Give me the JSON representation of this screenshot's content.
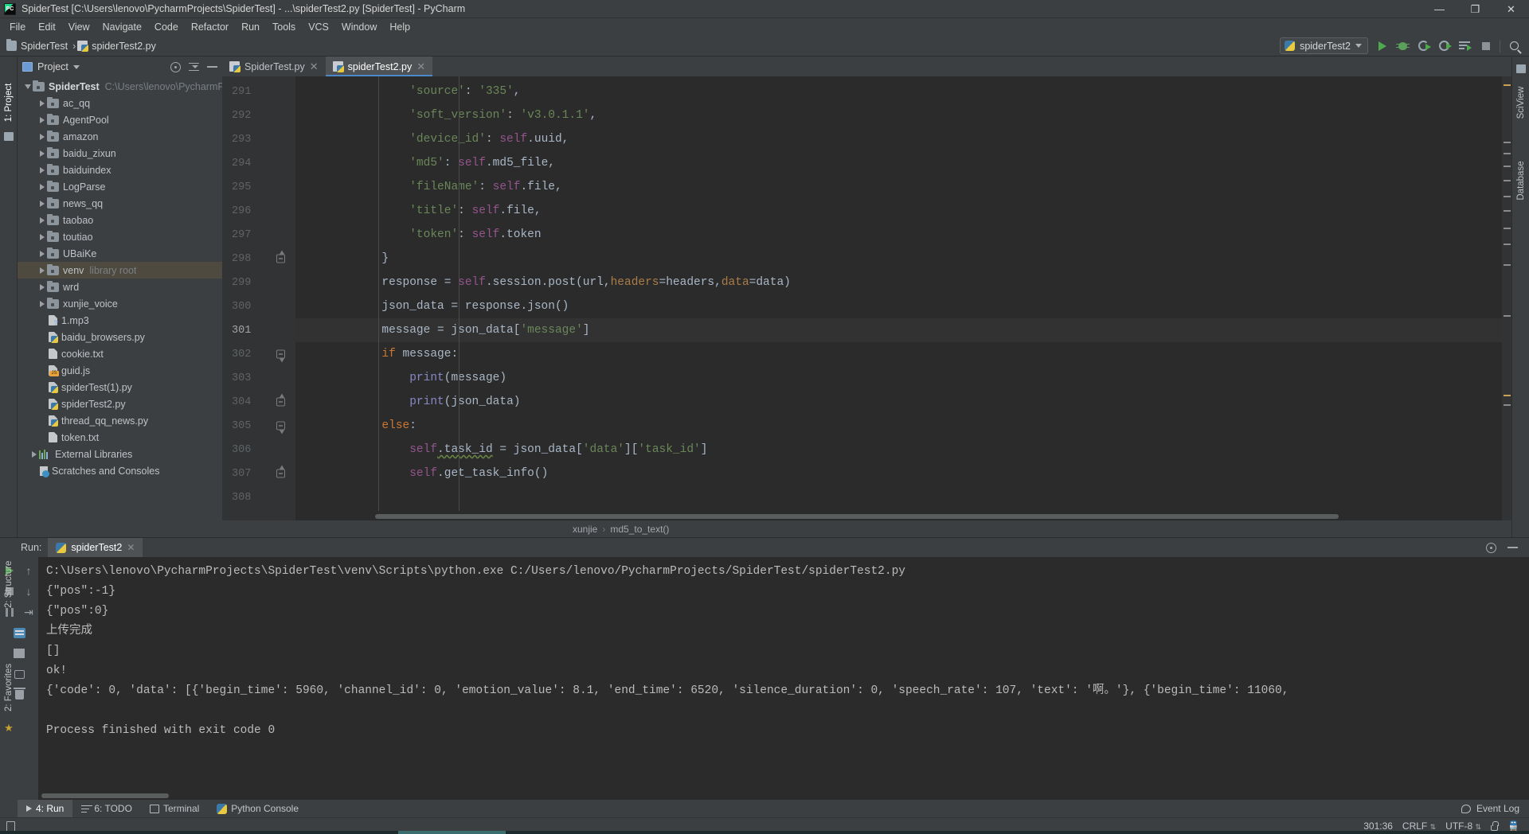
{
  "window": {
    "title": "SpiderTest [C:\\Users\\lenovo\\PycharmProjects\\SpiderTest] - ...\\spiderTest2.py [SpiderTest] - PyCharm",
    "minimize": "—",
    "maximize": "❐",
    "close": "✕"
  },
  "menu": [
    "File",
    "Edit",
    "View",
    "Navigate",
    "Code",
    "Refactor",
    "Run",
    "Tools",
    "VCS",
    "Window",
    "Help"
  ],
  "navbar": {
    "crumbs": [
      "SpiderTest",
      "spiderTest2.py"
    ],
    "run_config": "spiderTest2"
  },
  "left_strip": {
    "project_label": "1: Project",
    "structure_label": "2: Structure",
    "favorites_label": "2: Favorites"
  },
  "right_strip": {
    "sciview_label": "SciView",
    "database_label": "Database"
  },
  "project": {
    "title": "Project",
    "root": {
      "label": "SpiderTest",
      "path": "C:\\Users\\lenovo\\PycharmProjects\\Sp"
    },
    "items": [
      {
        "label": "ac_qq",
        "type": "folder"
      },
      {
        "label": "AgentPool",
        "type": "folder"
      },
      {
        "label": "amazon",
        "type": "folder"
      },
      {
        "label": "baidu_zixun",
        "type": "folder"
      },
      {
        "label": "baiduindex",
        "type": "folder"
      },
      {
        "label": "LogParse",
        "type": "folder"
      },
      {
        "label": "news_qq",
        "type": "folder"
      },
      {
        "label": "taobao",
        "type": "folder"
      },
      {
        "label": "toutiao",
        "type": "folder"
      },
      {
        "label": "UBaiKe",
        "type": "folder"
      },
      {
        "label": "venv",
        "type": "folder",
        "note": "library root",
        "selected": true
      },
      {
        "label": "wrd",
        "type": "folder"
      },
      {
        "label": "xunjie_voice",
        "type": "folder"
      },
      {
        "label": "1.mp3",
        "type": "unknown"
      },
      {
        "label": "baidu_browsers.py",
        "type": "py"
      },
      {
        "label": "cookie.txt",
        "type": "txt"
      },
      {
        "label": "guid.js",
        "type": "js"
      },
      {
        "label": "spiderTest(1).py",
        "type": "py"
      },
      {
        "label": "spiderTest2.py",
        "type": "py"
      },
      {
        "label": "thread_qq_news.py",
        "type": "py"
      },
      {
        "label": "token.txt",
        "type": "txt"
      },
      {
        "label": "External Libraries",
        "type": "lib"
      },
      {
        "label": "Scratches and Consoles",
        "type": "scratch"
      }
    ]
  },
  "editor": {
    "tabs": [
      {
        "label": "SpiderTest.py",
        "active": false,
        "close": "✕"
      },
      {
        "label": "spiderTest2.py",
        "active": true,
        "close": "✕"
      }
    ],
    "current_line": 301,
    "lines": [
      {
        "no": 291,
        "fold": "",
        "tokens": [
          {
            "t": "                ",
            "c": "tok-plain"
          },
          {
            "t": "'source'",
            "c": "tok-str"
          },
          {
            "t": ": ",
            "c": "tok-plain"
          },
          {
            "t": "'335'",
            "c": "tok-str"
          },
          {
            "t": ",",
            "c": "tok-plain"
          }
        ]
      },
      {
        "no": 292,
        "fold": "",
        "tokens": [
          {
            "t": "                ",
            "c": "tok-plain"
          },
          {
            "t": "'soft_version'",
            "c": "tok-str"
          },
          {
            "t": ": ",
            "c": "tok-plain"
          },
          {
            "t": "'v3.0.1.1'",
            "c": "tok-str"
          },
          {
            "t": ",",
            "c": "tok-plain"
          }
        ]
      },
      {
        "no": 293,
        "fold": "",
        "tokens": [
          {
            "t": "                ",
            "c": "tok-plain"
          },
          {
            "t": "'device_id'",
            "c": "tok-str"
          },
          {
            "t": ": ",
            "c": "tok-plain"
          },
          {
            "t": "self",
            "c": "tok-self"
          },
          {
            "t": ".uuid,",
            "c": "tok-plain"
          }
        ]
      },
      {
        "no": 294,
        "fold": "",
        "tokens": [
          {
            "t": "                ",
            "c": "tok-plain"
          },
          {
            "t": "'md5'",
            "c": "tok-str"
          },
          {
            "t": ": ",
            "c": "tok-plain"
          },
          {
            "t": "self",
            "c": "tok-self"
          },
          {
            "t": ".md5_file,",
            "c": "tok-plain"
          }
        ]
      },
      {
        "no": 295,
        "fold": "",
        "tokens": [
          {
            "t": "                ",
            "c": "tok-plain"
          },
          {
            "t": "'fileName'",
            "c": "tok-str"
          },
          {
            "t": ": ",
            "c": "tok-plain"
          },
          {
            "t": "self",
            "c": "tok-self"
          },
          {
            "t": ".file,",
            "c": "tok-plain"
          }
        ]
      },
      {
        "no": 296,
        "fold": "",
        "tokens": [
          {
            "t": "                ",
            "c": "tok-plain"
          },
          {
            "t": "'title'",
            "c": "tok-str"
          },
          {
            "t": ": ",
            "c": "tok-plain"
          },
          {
            "t": "self",
            "c": "tok-self"
          },
          {
            "t": ".file,",
            "c": "tok-plain"
          }
        ]
      },
      {
        "no": 297,
        "fold": "",
        "tokens": [
          {
            "t": "                ",
            "c": "tok-plain"
          },
          {
            "t": "'token'",
            "c": "tok-str"
          },
          {
            "t": ": ",
            "c": "tok-plain"
          },
          {
            "t": "self",
            "c": "tok-self"
          },
          {
            "t": ".token",
            "c": "tok-plain"
          }
        ]
      },
      {
        "no": 298,
        "fold": "up",
        "tokens": [
          {
            "t": "            }",
            "c": "tok-plain"
          }
        ]
      },
      {
        "no": 299,
        "fold": "",
        "tokens": [
          {
            "t": "            response = ",
            "c": "tok-plain"
          },
          {
            "t": "self",
            "c": "tok-self"
          },
          {
            "t": ".session.post(url,",
            "c": "tok-plain"
          },
          {
            "t": "headers",
            "c": "tok-kwarg"
          },
          {
            "t": "=headers,",
            "c": "tok-plain"
          },
          {
            "t": "data",
            "c": "tok-kwarg"
          },
          {
            "t": "=data)",
            "c": "tok-plain"
          }
        ]
      },
      {
        "no": 300,
        "fold": "",
        "tokens": [
          {
            "t": "            json_data = response.json()",
            "c": "tok-plain"
          }
        ]
      },
      {
        "no": 301,
        "fold": "",
        "tokens": [
          {
            "t": "            message = json_data[",
            "c": "tok-plain"
          },
          {
            "t": "'message'",
            "c": "tok-str"
          },
          {
            "t": "]",
            "c": "tok-plain"
          }
        ]
      },
      {
        "no": 302,
        "fold": "down",
        "tokens": [
          {
            "t": "            ",
            "c": "tok-plain"
          },
          {
            "t": "if",
            "c": "tok-kw"
          },
          {
            "t": " message:",
            "c": "tok-plain"
          }
        ]
      },
      {
        "no": 303,
        "fold": "",
        "tokens": [
          {
            "t": "                ",
            "c": "tok-plain"
          },
          {
            "t": "print",
            "c": "tok-fn"
          },
          {
            "t": "(message)",
            "c": "tok-plain"
          }
        ]
      },
      {
        "no": 304,
        "fold": "up",
        "tokens": [
          {
            "t": "                ",
            "c": "tok-plain"
          },
          {
            "t": "print",
            "c": "tok-fn"
          },
          {
            "t": "(json_data)",
            "c": "tok-plain"
          }
        ]
      },
      {
        "no": 305,
        "fold": "down",
        "tokens": [
          {
            "t": "            ",
            "c": "tok-plain"
          },
          {
            "t": "else",
            "c": "tok-kw"
          },
          {
            "t": ":",
            "c": "tok-plain"
          }
        ]
      },
      {
        "no": 306,
        "fold": "",
        "tokens": [
          {
            "t": "                ",
            "c": "tok-plain"
          },
          {
            "t": "self",
            "c": "tok-self"
          },
          {
            "t": ".task_id",
            "c": "tok-plain tok-warn"
          },
          {
            "t": " = json_data[",
            "c": "tok-plain"
          },
          {
            "t": "'data'",
            "c": "tok-str"
          },
          {
            "t": "][",
            "c": "tok-plain"
          },
          {
            "t": "'task_id'",
            "c": "tok-str"
          },
          {
            "t": "]",
            "c": "tok-plain"
          }
        ]
      },
      {
        "no": 307,
        "fold": "up",
        "tokens": [
          {
            "t": "                ",
            "c": "tok-plain"
          },
          {
            "t": "self",
            "c": "tok-self"
          },
          {
            "t": ".get_task_info()",
            "c": "tok-plain"
          }
        ]
      },
      {
        "no": 308,
        "fold": "",
        "tokens": [
          {
            "t": "",
            "c": "tok-plain"
          }
        ]
      }
    ],
    "breadcrumbs": [
      "xunjie",
      "md5_to_text()"
    ]
  },
  "run_panel": {
    "label": "Run:",
    "tab": "spiderTest2",
    "tab_close": "✕",
    "output": [
      "C:\\Users\\lenovo\\PycharmProjects\\SpiderTest\\venv\\Scripts\\python.exe C:/Users/lenovo/PycharmProjects/SpiderTest/spiderTest2.py",
      "{\"pos\":-1}",
      "{\"pos\":0}",
      "上传完成",
      "[]",
      "ok!",
      "{'code': 0, 'data': [{'begin_time': 5960, 'channel_id': 0, 'emotion_value': 8.1, 'end_time': 6520, 'silence_duration': 0, 'speech_rate': 107, 'text': '啊。'}, {'begin_time': 11060,",
      "",
      "Process finished with exit code 0"
    ]
  },
  "bottom_bar": {
    "items": [
      {
        "label": "4: Run",
        "underline": "4",
        "active": true,
        "icon": "play-icon"
      },
      {
        "label": "6: TODO",
        "underline": "6",
        "active": false,
        "icon": "list-icon"
      },
      {
        "label": "Terminal",
        "underline": "",
        "active": false,
        "icon": "terminal-icon"
      },
      {
        "label": "Python Console",
        "underline": "",
        "active": false,
        "icon": "python-icon"
      }
    ],
    "event_log": "Event Log"
  },
  "status_bar": {
    "caret": "301:36",
    "line_sep": "CRLF",
    "encoding": "UTF-8",
    "lock": "lock-icon",
    "train": "train-icon"
  },
  "colors": {
    "bg_panel": "#3c3f41",
    "bg_editor": "#2b2b2b",
    "accent_tab": "#4a88c7",
    "selection": "#4e4a3f",
    "string": "#6a8759",
    "keyword": "#cc7832",
    "self": "#94558d",
    "function": "#8888c6",
    "plain": "#a9b7c6",
    "run_green": "#4ea84e"
  }
}
